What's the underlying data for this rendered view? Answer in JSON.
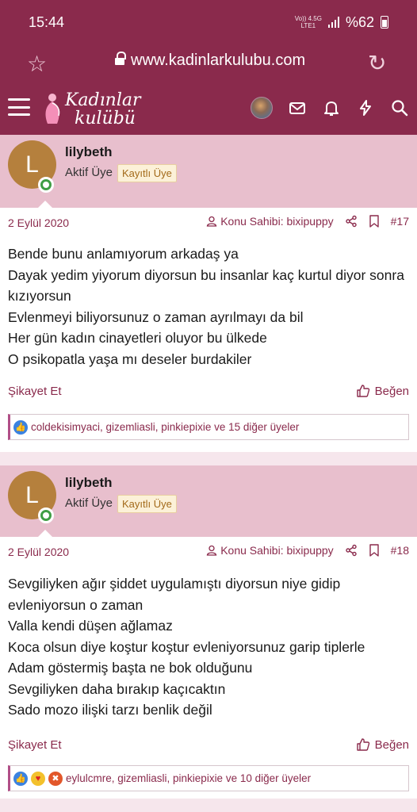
{
  "status_bar": {
    "time": "15:44",
    "network_top": "Vo)) 4.5G",
    "network_bottom": "LTE1",
    "battery": "%62"
  },
  "browser": {
    "url": "www.kadinlarkulubu.com"
  },
  "site": {
    "logo_line1": "Kadınlar",
    "logo_line2": "kulübü"
  },
  "posts": [
    {
      "username": "lilybeth",
      "avatar_letter": "L",
      "user_title": "Aktif Üye",
      "badge": "Kayıtlı Üye",
      "date": "2 Eylül 2020",
      "thread_starter": "Konu Sahibi: bixipuppy",
      "post_number": "#17",
      "lines": [
        "Bende bunu anlamıyorum arkadaş ya",
        "Dayak yedim yiyorum diyorsun bu insanlar kaç kurtul diyor sonra kızıyorsun",
        "Evlenmeyi biliyorsunuz o zaman ayrılmayı da bil",
        "Her gün kadın cinayetleri oluyor bu ülkede",
        "O psikopatla yaşa mı deseler burdakiler"
      ],
      "report_label": "Şikayet Et",
      "like_label": "Beğen",
      "reactions_text": "coldekisimyaci, gizemliasli, pinkiepixie ve 15 diğer üyeler"
    },
    {
      "username": "lilybeth",
      "avatar_letter": "L",
      "user_title": "Aktif Üye",
      "badge": "Kayıtlı Üye",
      "date": "2 Eylül 2020",
      "thread_starter": "Konu Sahibi: bixipuppy",
      "post_number": "#18",
      "lines": [
        "Sevgiliyken ağır şiddet uygulamıştı diyorsun niye gidip evleniyorsun o zaman",
        "Valla kendi düşen ağlamaz",
        "Koca olsun diye koştur koştur evleniyorsunuz garip tiplerle",
        "Adam göstermiş başta ne bok olduğunu",
        "Sevgiliyken daha bırakıp kaçıcaktın",
        "Sado mozo ilişki tarzı benlik değil"
      ],
      "report_label": "Şikayet Et",
      "like_label": "Beğen",
      "reactions_text": "eylulcmre, gizemliasli, pinkiepixie ve 10 diğer üyeler"
    }
  ],
  "colors": {
    "brand": "#8a2a4c",
    "userbar": "#e8bfcd",
    "page_bg": "#f6e6ec"
  },
  "icons": {
    "statusbar": [
      "signal-icon",
      "battery-icon"
    ],
    "browser": [
      "star-icon",
      "lock-icon",
      "reload-icon"
    ],
    "header": [
      "menu-icon",
      "avatar",
      "mail-icon",
      "bell-icon",
      "bolt-icon",
      "search-icon"
    ],
    "post": [
      "user-icon",
      "share-icon",
      "bookmark-icon",
      "thumbs-up-icon",
      "reaction-like-icon",
      "reaction-love-icon",
      "reaction-angry-icon"
    ]
  }
}
